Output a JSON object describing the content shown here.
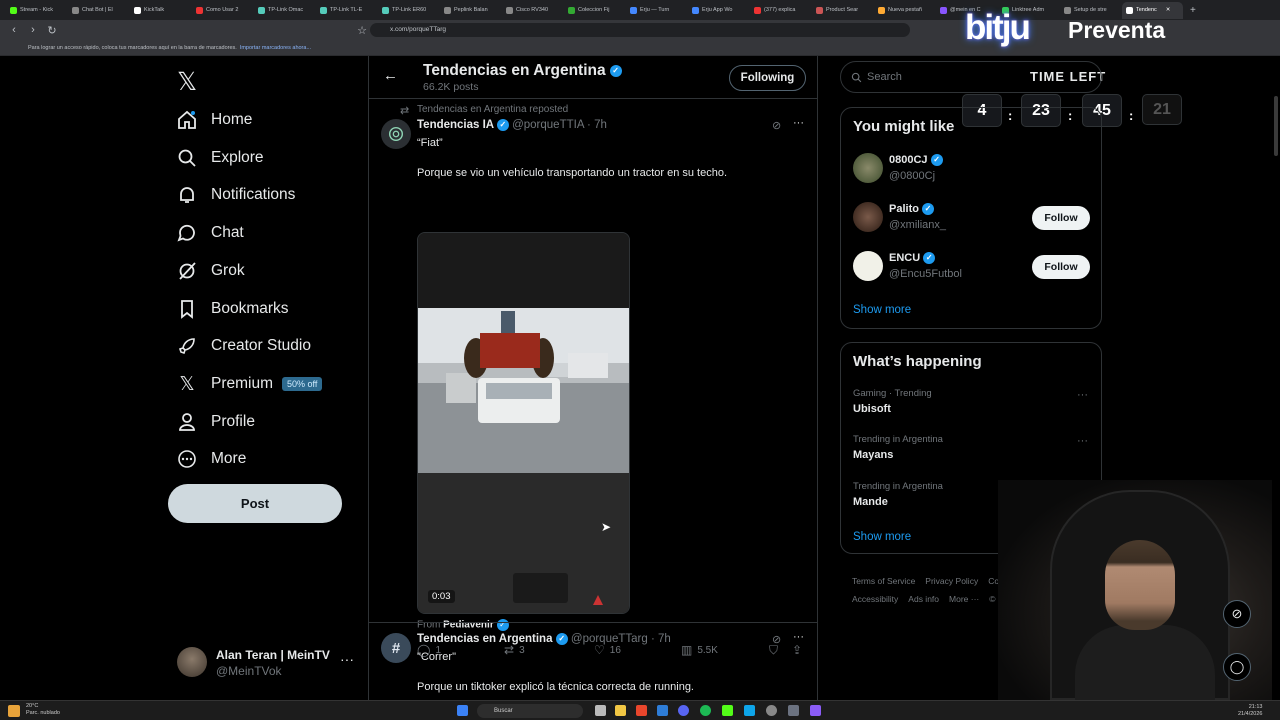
{
  "browser": {
    "tabs": [
      "Stream - Kick",
      "Chat Bot | El",
      "KickTalk",
      "Como Usar 2",
      "TP-Link Omac",
      "TP-Link TL-E",
      "TP-Link ER60",
      "Peplink Balan",
      "Cisco RV340",
      "Coleccion Fij",
      "Erju — Turn",
      "Erju App Wo",
      "(377) explica",
      "Product Sear",
      "Nueva pestañ",
      "@mein en C",
      "Linktree Adm",
      "Setup de stre",
      "Tendenc"
    ],
    "url": "x.com/porqueTTarg",
    "bookmarks_text": "Para lograr un acceso rápido, coloca tus marcadores aquí en la barra de marcadores.",
    "bookmarks_link": "Importar marcadores ahora..."
  },
  "overlay": {
    "brand": "bitju",
    "preventa": "Preventa",
    "time_left": "TIME LEFT",
    "t1": "4",
    "t2": "23",
    "t3": "45",
    "t4": "21"
  },
  "sidebar": {
    "nav": {
      "home": "Home",
      "explore": "Explore",
      "notifications": "Notifications",
      "chat": "Chat",
      "grok": "Grok",
      "bookmarks": "Bookmarks",
      "creator": "Creator Studio",
      "premium": "Premium",
      "premium_badge": "50% off",
      "profile": "Profile",
      "more": "More"
    },
    "post": "Post",
    "account_name": "Alan Teran | MeinTV",
    "account_handle": "@MeinTVok"
  },
  "feed": {
    "title": "Tendencias en Argentina",
    "posts_count": "66.2K posts",
    "following": "Following",
    "tweet1": {
      "repost_label": "Tendencias en Argentina reposted",
      "name": "Tendencias IA",
      "handle": "@porqueTTIA · 7h",
      "line1": "“Fiat”",
      "line2": "Porque se vio un vehículo transportando un tractor en su techo.",
      "video_time": "0:03",
      "from_label": "From",
      "from_name": "Pediavenir",
      "replies": "1",
      "reposts": "3",
      "likes": "16",
      "views": "5.5K"
    },
    "tweet2": {
      "name": "Tendencias en Argentina",
      "handle": "@porqueTTarg · 7h",
      "line1": "\"Correr\"",
      "line2": "Porque un tiktoker explicó la técnica correcta de running."
    }
  },
  "right": {
    "search_placeholder": "Search",
    "you_might_like": "You might like",
    "users": [
      {
        "name": "0800CJ",
        "handle": "@0800Cj",
        "btn": "Follow"
      },
      {
        "name": "Palito",
        "handle": "@xmilianx_",
        "btn": "Follow"
      },
      {
        "name": "ENCU",
        "handle": "@Encu5Futbol",
        "btn": "Follow"
      }
    ],
    "show_more": "Show more",
    "whats_happening": "What’s happening",
    "trends": [
      {
        "meta": "Gaming · Trending",
        "name": "Ubisoft"
      },
      {
        "meta": "Trending in Argentina",
        "name": "Mayans"
      },
      {
        "meta": "Trending in Argentina",
        "name": "Mande"
      }
    ],
    "show_more2": "Show more",
    "footer": {
      "terms": "Terms of Service",
      "privacy": "Privacy Policy",
      "cookie": "Cookie Po",
      "access": "Accessibility",
      "ads": "Ads info",
      "more": "More ···",
      "copy": "© 20"
    }
  },
  "taskbar": {
    "temp": "20°C",
    "weather": "Parc. nublado",
    "search": "Buscar",
    "time": "21:13",
    "date": "21/4/2026"
  }
}
